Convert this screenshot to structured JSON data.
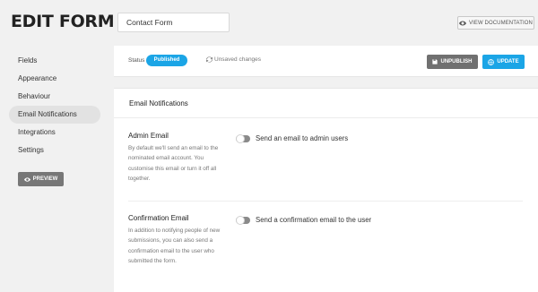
{
  "header": {
    "title": "EDIT FORM",
    "form_name": "Contact Form",
    "view_documentation": "VIEW DOCUMENTATION"
  },
  "sidebar": {
    "items": [
      {
        "label": "Fields"
      },
      {
        "label": "Appearance"
      },
      {
        "label": "Behaviour"
      },
      {
        "label": "Email Notifications",
        "active": true
      },
      {
        "label": "Integrations"
      },
      {
        "label": "Settings"
      }
    ],
    "preview_label": "PREVIEW"
  },
  "status_bar": {
    "status_label": "Status",
    "status_value": "Published",
    "unsaved_text": "Unsaved changes",
    "unpublish_label": "UNPUBLISH",
    "update_label": "UPDATE"
  },
  "card": {
    "title": "Email Notifications",
    "sections": [
      {
        "title": "Admin Email",
        "description": "By default we'll send an email to the nominated email account. You customise this email or turn it off all together.",
        "toggle_label": "Send an email to admin users",
        "enabled": false
      },
      {
        "title": "Confirmation Email",
        "description": "In addition to notifying people of new submissions, you can also send a confirmation email to the user who submitted the form.",
        "toggle_label": "Send a confirmation email to the user",
        "enabled": false
      }
    ]
  },
  "colors": {
    "accent": "#1ba5e6",
    "button_gray": "#707070",
    "background": "#f1f1f1"
  }
}
